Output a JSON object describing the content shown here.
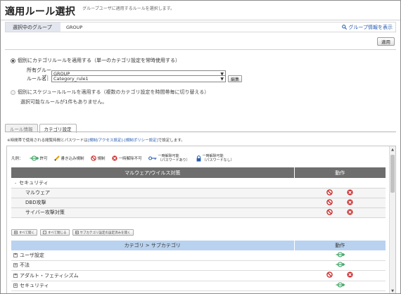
{
  "page": {
    "title": "適用ルール選択",
    "subtitle": "グループユーザに適用するルールを選択します。"
  },
  "group_bar": {
    "label": "選択中のグループ",
    "value": "GROUP",
    "link": "グループ情報を表示"
  },
  "apply_label": "適用",
  "option_category": {
    "label": "個別にカテゴリルールを適用する（単一のカテゴリ設定を常時使用する）",
    "owner_label": "所有グループ：",
    "owner_value": "GROUP",
    "rule_label": "ルール名：",
    "rule_value": "Category_rule1",
    "edit_label": "編集"
  },
  "option_schedule": {
    "label": "個別にスケジュールルールを適用する（複数のカテゴリ設定を時間帯毎に切り替える）",
    "note": "選択可能なルールが1件もありません。"
  },
  "tabs": [
    {
      "label": "ルール情報",
      "active": false
    },
    {
      "label": "カテゴリ設定",
      "active": true
    }
  ],
  "description": {
    "before": "※時間帯で使用される閲覧時間とパスワードは",
    "link": "[規制/アクセス設定]-[規制ポリシー設定]",
    "after": "で設定します。"
  },
  "legend": {
    "label": "凡例：",
    "items": [
      {
        "label": "許可",
        "icon": "allow-icon"
      },
      {
        "label": "書き込み規制",
        "icon": "write-restrict-icon"
      },
      {
        "label": "規制",
        "icon": "block-icon"
      },
      {
        "label": "一時解除不可",
        "icon": "no-temp-release-icon"
      },
      {
        "label": "一時解除可能",
        "sub": "（パスワードあり）",
        "icon": "key-icon"
      },
      {
        "label": "一時解除可能",
        "sub": "（パスワードなし）",
        "icon": "lock-icon"
      }
    ]
  },
  "malware_table": {
    "header": "マルウェア/ウイルス対策",
    "action_header": "動作",
    "group": "セキュリティ",
    "rows": [
      {
        "label": "マルウェア"
      },
      {
        "label": "DBD攻撃"
      },
      {
        "label": "サイバー攻撃対策"
      }
    ]
  },
  "expand_buttons": {
    "expand_all": "すべて開く",
    "collapse_all": "すべて閉じる",
    "show_set": "サブカテゴリ設定の設定済みを開く"
  },
  "category_table": {
    "header": "カテゴリ > サブカテゴリ",
    "action_header": "動作",
    "rows": [
      {
        "label": "ユーザ設定",
        "action": "allow"
      },
      {
        "label": "不法",
        "action": "allow"
      },
      {
        "label": "アダルト・フェティシズム",
        "action": "block"
      },
      {
        "label": "セキュリティ",
        "action": "allow"
      }
    ]
  },
  "colors": {
    "allow": "#2e9e5a",
    "block": "#cc2a2a",
    "header_dark": "#6e6e6e",
    "header_blue": "#b9d2ef",
    "link": "#2a5db0"
  }
}
